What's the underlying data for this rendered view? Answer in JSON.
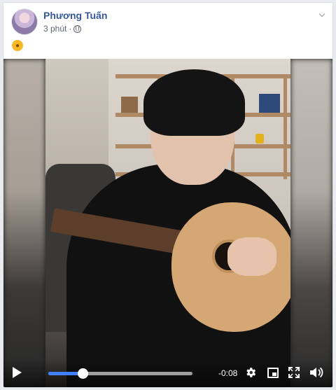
{
  "post": {
    "author_name": "Phương Tuấn",
    "time_ago": "3 phút",
    "separator": "·",
    "reaction_icon": "lion-emoji-icon"
  },
  "video": {
    "progress": 0.24,
    "remaining_time": "-0:08"
  },
  "colors": {
    "author_link": "#365899",
    "progress_accent": "#4080ff"
  }
}
